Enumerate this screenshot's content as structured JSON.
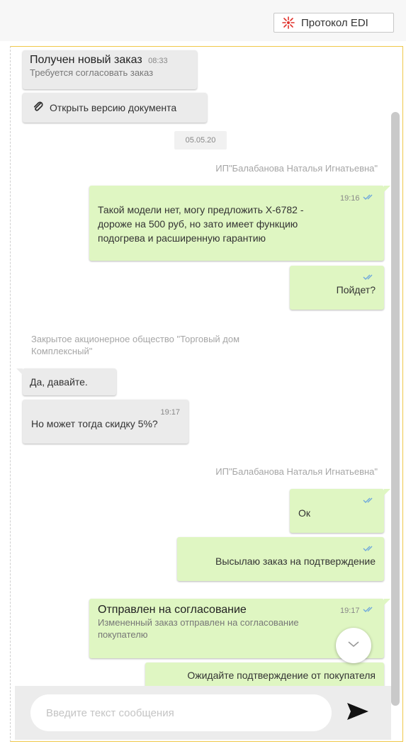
{
  "toolbar": {
    "edi_label": "Протокол EDI",
    "edi_icon": "edi-protocol-icon",
    "accent": "#e0302a"
  },
  "messages": [
    {
      "title": "Получен новый заказ",
      "time": "08:33",
      "text": "Требуется согласовать заказ"
    },
    {
      "label": "Открыть версию документа",
      "icon": "paperclip-icon"
    },
    {
      "date": "05.05.20"
    },
    {
      "sender": "ИП\"Балабанова Наталья Игнатьевна\""
    },
    {
      "time": "19:16",
      "lines": [
        "Такой модели нет, могу предложить Х-6782 -",
        "дороже на 500 руб, но зато имеет функцию",
        "подогрева и расширенную гарантию"
      ]
    },
    {
      "text": "Пойдет?"
    },
    {
      "sender_lines": [
        "Закрытое акционерное общество \"Торговый дом",
        "Комплексный\""
      ]
    },
    {
      "text": "Да, давайте."
    },
    {
      "time": "19:17",
      "text": "Но может тогда скидку 5%?"
    },
    {
      "sender": "ИП\"Балабанова Наталья Игнатьевна\""
    },
    {
      "text": "Ок"
    },
    {
      "text": "Высылаю заказ на подтверждение"
    },
    {
      "title": "Отправлен на согласование",
      "time": "19:17",
      "lines": [
        "Измененный заказ отправлен на согласование",
        "покупателю"
      ]
    },
    {
      "text": "Ожидайте подтверждение от покупателя"
    }
  ],
  "composer": {
    "placeholder": "Введите текст сообщения",
    "send_icon": "send-icon"
  },
  "colors": {
    "incoming": "#ebebeb",
    "outgoing": "#dff6c2",
    "frame": "#f0c84a",
    "ticks": "#6fa8dc"
  }
}
